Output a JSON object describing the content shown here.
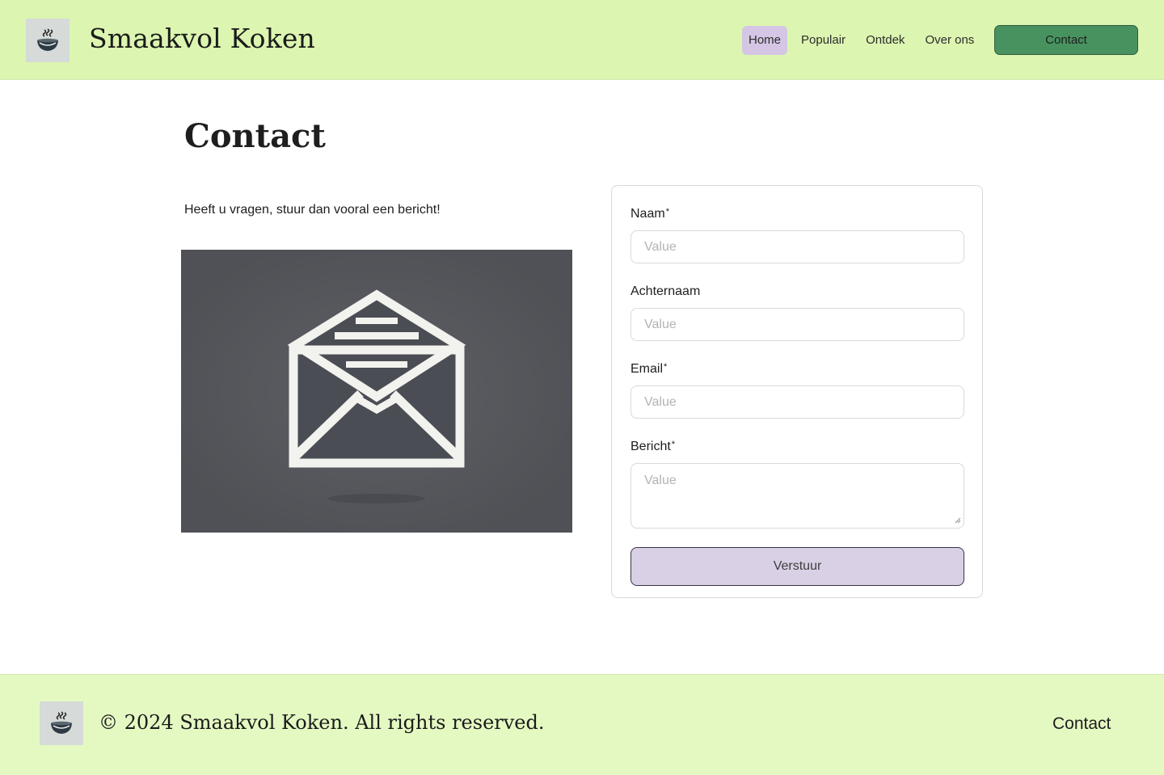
{
  "header": {
    "site_title": "Smaakvol Koken",
    "logo_icon": "steaming-bowl-icon",
    "nav": [
      "Home",
      "Populair",
      "Ontdek",
      "Over ons"
    ],
    "active_nav": "Home",
    "contact_button": "Contact"
  },
  "main": {
    "title": "Contact",
    "intro": "Heeft u vragen, stuur dan vooral een bericht!",
    "image_icon": "open-envelope-icon",
    "form": {
      "fields": [
        {
          "label": "Naam",
          "required": "*",
          "placeholder": "Value"
        },
        {
          "label": "Achternaam",
          "required": "",
          "placeholder": "Value"
        },
        {
          "label": "Email",
          "required": "*",
          "placeholder": "Value"
        },
        {
          "label": "Bericht",
          "required": "*",
          "placeholder": "Value"
        }
      ],
      "submit_label": "Verstuur"
    }
  },
  "footer": {
    "copyright": "© 2024 Smaakvol Koken. All rights reserved.",
    "link": "Contact"
  },
  "colors": {
    "header_bg": "#dcf5b0",
    "footer_bg": "#e4f9c2",
    "active_nav_bg": "#d4c6e4",
    "contact_button_bg": "#48925f",
    "submit_bg": "#d9d0e6"
  }
}
